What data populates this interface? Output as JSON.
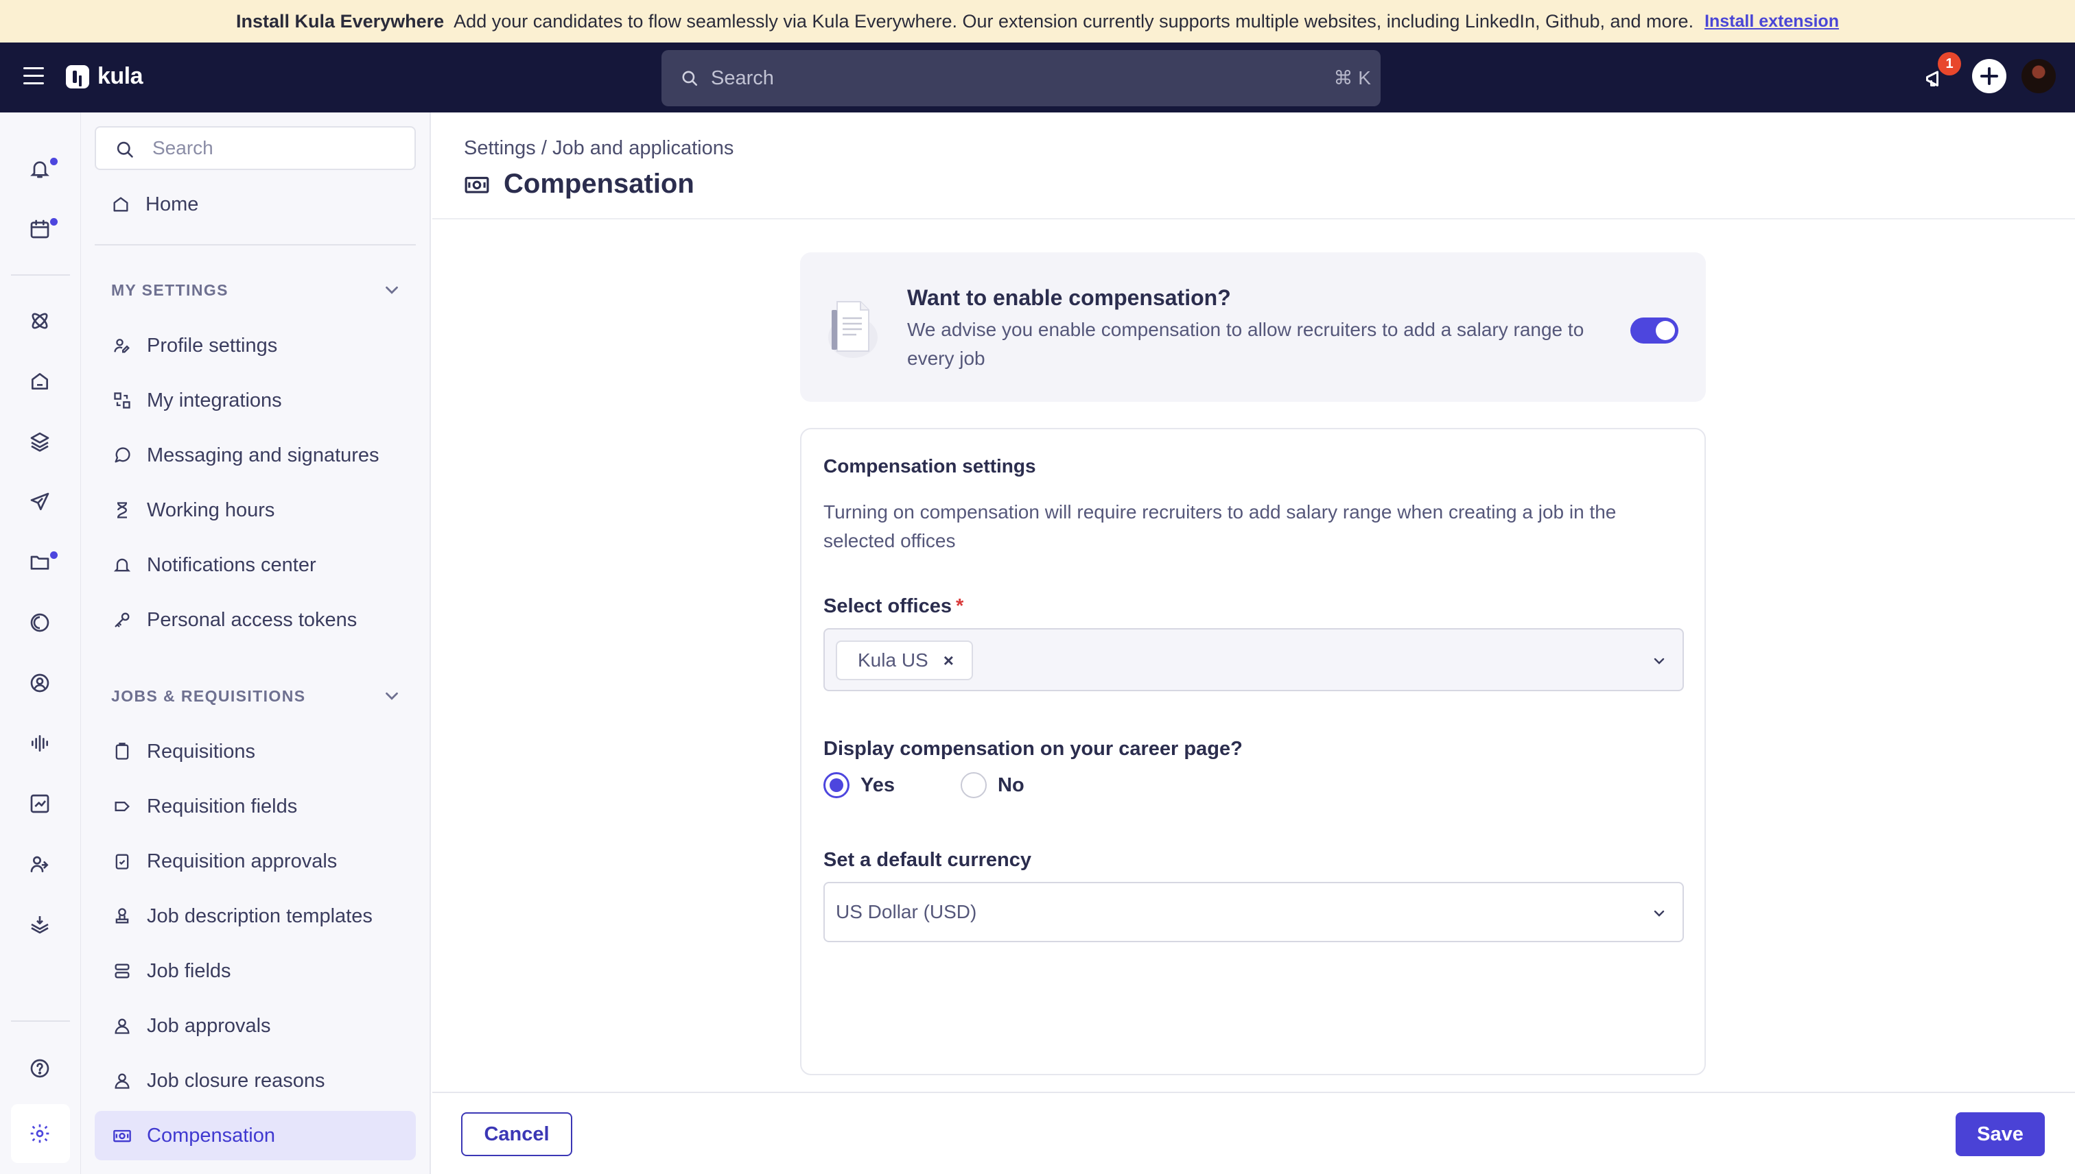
{
  "banner": {
    "title": "Install Kula Everywhere",
    "message": "Add your candidates to flow seamlessly via Kula Everywhere. Our extension currently supports multiple websites, including LinkedIn, Github, and more.",
    "link": "Install extension"
  },
  "topnav": {
    "brand": "kula",
    "search_placeholder": "Search",
    "shortcut": "⌘ K",
    "notification_count": "1"
  },
  "rail": {
    "icons": [
      "bell-icon",
      "calendar-icon",
      "atom-icon",
      "home-icon",
      "layers-icon",
      "send-icon",
      "folder-icon",
      "half-circle-icon",
      "user-circle-icon",
      "audio-wave-icon",
      "chart-icon",
      "users-icon",
      "download-stack-icon",
      "help-icon",
      "gear-icon"
    ]
  },
  "sidebar": {
    "search_placeholder": "Search",
    "home": "Home",
    "my_settings": {
      "title": "MY SETTINGS",
      "items": [
        "Profile settings",
        "My integrations",
        "Messaging and signatures",
        "Working hours",
        "Notifications center",
        "Personal access tokens"
      ]
    },
    "jobs": {
      "title": "JOBS & REQUISITIONS",
      "items": [
        "Requisitions",
        "Requisition fields",
        "Requisition approvals",
        "Job description templates",
        "Job fields",
        "Job approvals",
        "Job closure reasons",
        "Compensation"
      ]
    }
  },
  "main": {
    "breadcrumb": "Settings / Job and applications",
    "title": "Compensation",
    "enable": {
      "title": "Want to enable compensation?",
      "description": "We advise you enable compensation to allow recruiters to add a salary range to every job",
      "enabled": true
    },
    "settings": {
      "title": "Compensation settings",
      "description": "Turning on compensation will require recruiters to add salary range when creating a job in the selected offices",
      "offices_label": "Select offices",
      "required_mark": "*",
      "offices": [
        "Kula US"
      ],
      "chip_remove": "×",
      "display_label": "Display compensation on your career page?",
      "yes": "Yes",
      "no": "No",
      "currency_label": "Set a default currency",
      "currency_value": "US Dollar (USD)"
    }
  },
  "footer": {
    "cancel": "Cancel",
    "save": "Save"
  },
  "colors": {
    "accent": "#4d46de",
    "nav_bg": "#15173a",
    "banner_bg": "#fbf0d2"
  }
}
